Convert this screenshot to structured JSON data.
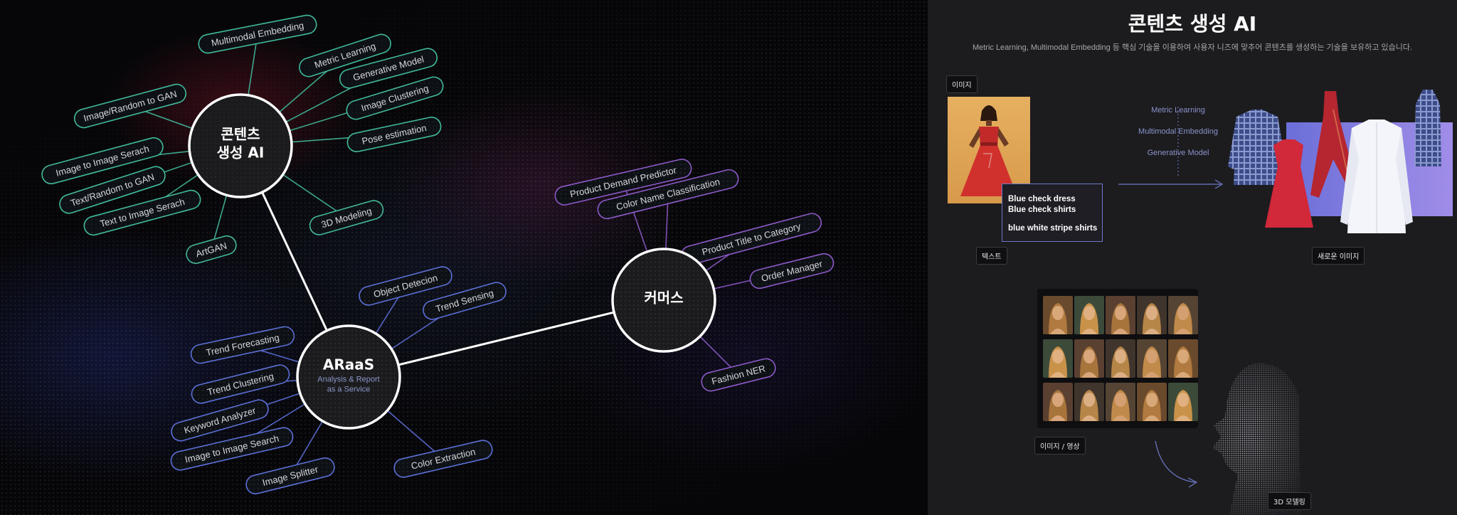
{
  "mindmap": {
    "hubs": [
      {
        "id": "content",
        "title_lines": [
          "콘텐츠",
          "생성 AI"
        ],
        "subtitle_lines": []
      },
      {
        "id": "araas",
        "title_lines": [
          "ARaaS"
        ],
        "subtitle_lines": [
          "Analysis & Report",
          "as a Service"
        ]
      },
      {
        "id": "commerce",
        "title_lines": [
          "커머스"
        ],
        "subtitle_lines": []
      }
    ],
    "content_nodes": [
      "Multimodal Embedding",
      "Metric Learning",
      "Generative Model",
      "Image Clustering",
      "Pose estimation",
      "Image/Random to GAN",
      "Image to Image Serach",
      "Text/Random to GAN",
      "Text to Image Serach",
      "ArtGAN",
      "3D Modeling"
    ],
    "araas_nodes": [
      "Object Detecion",
      "Trend Sensing",
      "Trend Forecasting",
      "Trend Clustering",
      "Keyword Analyzer",
      "Image to Image Search",
      "Image Splitter",
      "Color Extraction"
    ],
    "commerce_nodes": [
      "Product Demand Predictor",
      "Color Name Classification",
      "Product Title to Category",
      "Order Manager",
      "Fashion NER"
    ],
    "colors": {
      "content": "#3fb99a",
      "araas": "#5a6ed8",
      "commerce": "#8b58c8",
      "hub_fill": "#1b1b1d",
      "hub_stroke": "#ffffff",
      "pill_fill": "#0d1014"
    }
  },
  "panel": {
    "title": "콘텐츠 생성 AI",
    "description": "Metric Learning, Multimodal Embedding 등 핵심 기술을 이용하여 사용자 니즈에 맞추어 콘텐츠를 생성하는 기술을 보유하고 있습니다.",
    "tags": {
      "image": "이미지",
      "text": "텍스트",
      "new_image": "새로운 이미지",
      "image_video": "이미지 / 영상",
      "modeling": "3D 모델링"
    },
    "text_lines": [
      "Blue check dress",
      "Blue check shirts",
      "blue white stripe shirts"
    ],
    "models": [
      "Metric Learning",
      "Multimodal Embedding",
      "Generative Model"
    ]
  }
}
